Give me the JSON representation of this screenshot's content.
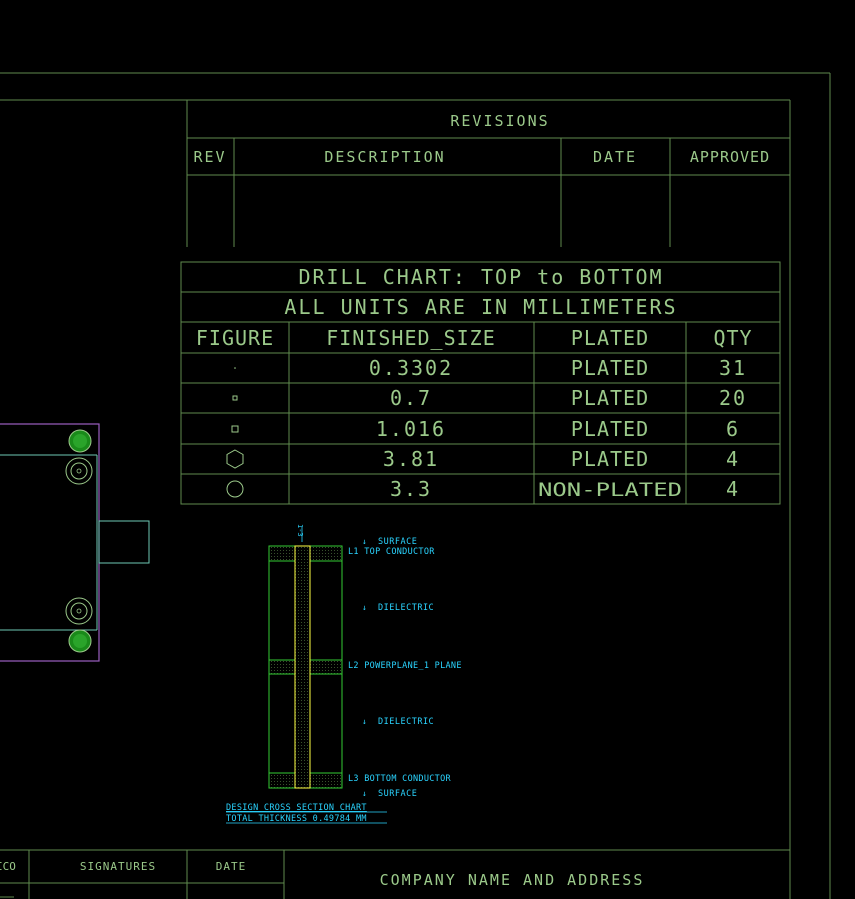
{
  "revisions": {
    "title": "REVISIONS",
    "headers": [
      "REV",
      "DESCRIPTION",
      "DATE",
      "APPROVED"
    ]
  },
  "drill_chart": {
    "title": "DRILL CHART: TOP to BOTTOM",
    "units": "ALL UNITS ARE IN MILLIMETERS",
    "headers": [
      "FIGURE",
      "FINISHED_SIZE",
      "PLATED",
      "QTY"
    ],
    "rows": [
      {
        "figure": "dot-icon",
        "size": "0.3302",
        "plated": "PLATED",
        "qty": "31"
      },
      {
        "figure": "small-diamond-icon",
        "size": "0.7",
        "plated": "PLATED",
        "qty": "20"
      },
      {
        "figure": "small-square-icon",
        "size": "1.016",
        "plated": "PLATED",
        "qty": "6"
      },
      {
        "figure": "hexagon-icon",
        "size": "3.81",
        "plated": "PLATED",
        "qty": "4"
      },
      {
        "figure": "circle-icon",
        "size": "3.3",
        "plated": "NON-PLATED",
        "qty": "4"
      }
    ]
  },
  "stackup": {
    "top_mark": "1-3",
    "labels": {
      "surface_top": "SURFACE",
      "l1": "L1 TOP CONDUCTOR",
      "dielectric_1": "DIELECTRIC",
      "l2": "L2 POWERPLANE_1 PLANE",
      "dielectric_2": "DIELECTRIC",
      "l3": "L3 BOTTOM CONDUCTOR",
      "surface_bottom": "SURFACE"
    },
    "caption_1": "DESIGN CROSS SECTION CHART",
    "caption_2": "TOTAL THICKNESS 0.49784 MM"
  },
  "title_block": {
    "partial_label": "ICO",
    "signatures": "SIGNATURES",
    "date": "DATE",
    "company": "COMPANY NAME AND ADDRESS"
  },
  "colors": {
    "line": "#5f8a4e",
    "text": "#9bc98a",
    "cyan": "#2ad4ff",
    "board_outline": "#9b5fc0",
    "pad": "#1a8a1a"
  }
}
